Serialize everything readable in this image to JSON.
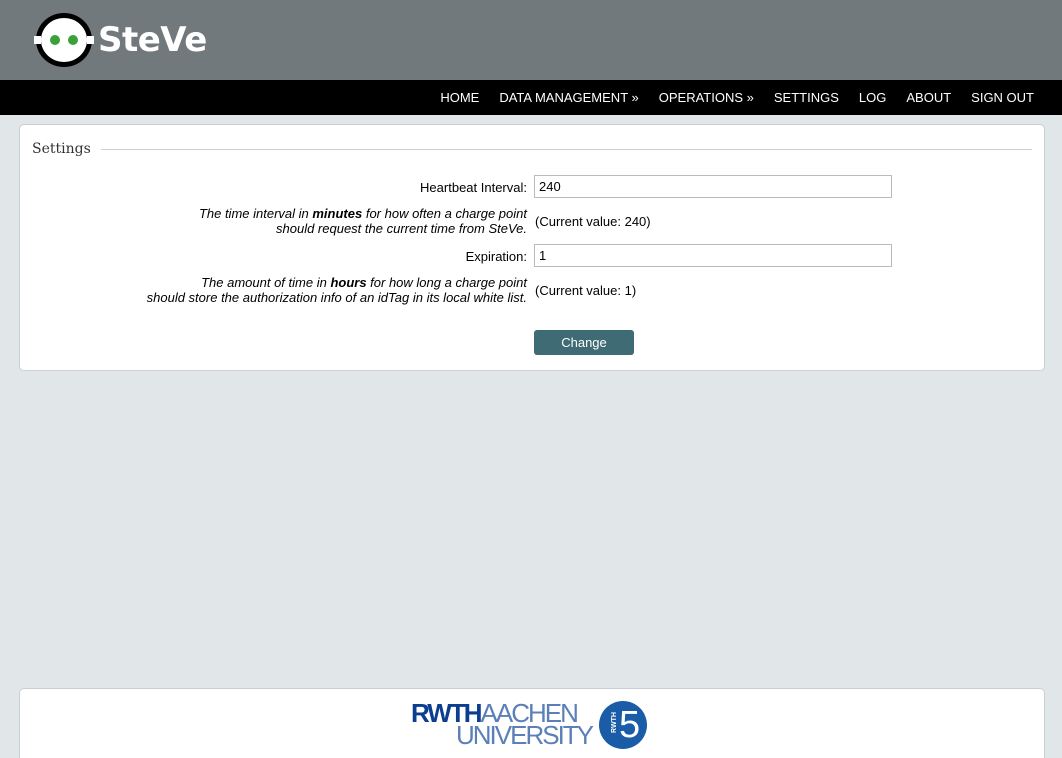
{
  "header": {
    "brand": "SteVe",
    "logo_icon": "robot-face-icon"
  },
  "nav": {
    "items": [
      {
        "label": "HOME"
      },
      {
        "label": "DATA MANAGEMENT »"
      },
      {
        "label": "OPERATIONS »"
      },
      {
        "label": "SETTINGS"
      },
      {
        "label": "LOG"
      },
      {
        "label": "ABOUT"
      },
      {
        "label": "SIGN OUT"
      }
    ]
  },
  "settings": {
    "legend": "Settings",
    "heartbeat": {
      "label": "Heartbeat Interval:",
      "value": "240",
      "desc_pre": "The time interval in ",
      "desc_bold": "minutes",
      "desc_post": " for how often a charge point",
      "desc_line2": "should request the current time from SteVe.",
      "current": "(Current value: 240)"
    },
    "expiration": {
      "label": "Expiration:",
      "value": "1",
      "desc_pre": "The amount of time in ",
      "desc_bold": "hours",
      "desc_post": " for how long a charge point",
      "desc_line2": "should store the authorization info of an idTag in its local white list.",
      "current": "(Current value: 1)"
    },
    "change_label": "Change"
  },
  "footer": {
    "rwth_part1": "RWTH",
    "rwth_part2": "AACHEN",
    "rwth_part3": "UNIVERSITY",
    "i5_small": "RWTH",
    "i5_number": "5"
  },
  "colors": {
    "header_bg": "#71797c",
    "nav_bg": "#000000",
    "button_bg": "#3f6b75",
    "page_bg": "#e1e6e9"
  }
}
